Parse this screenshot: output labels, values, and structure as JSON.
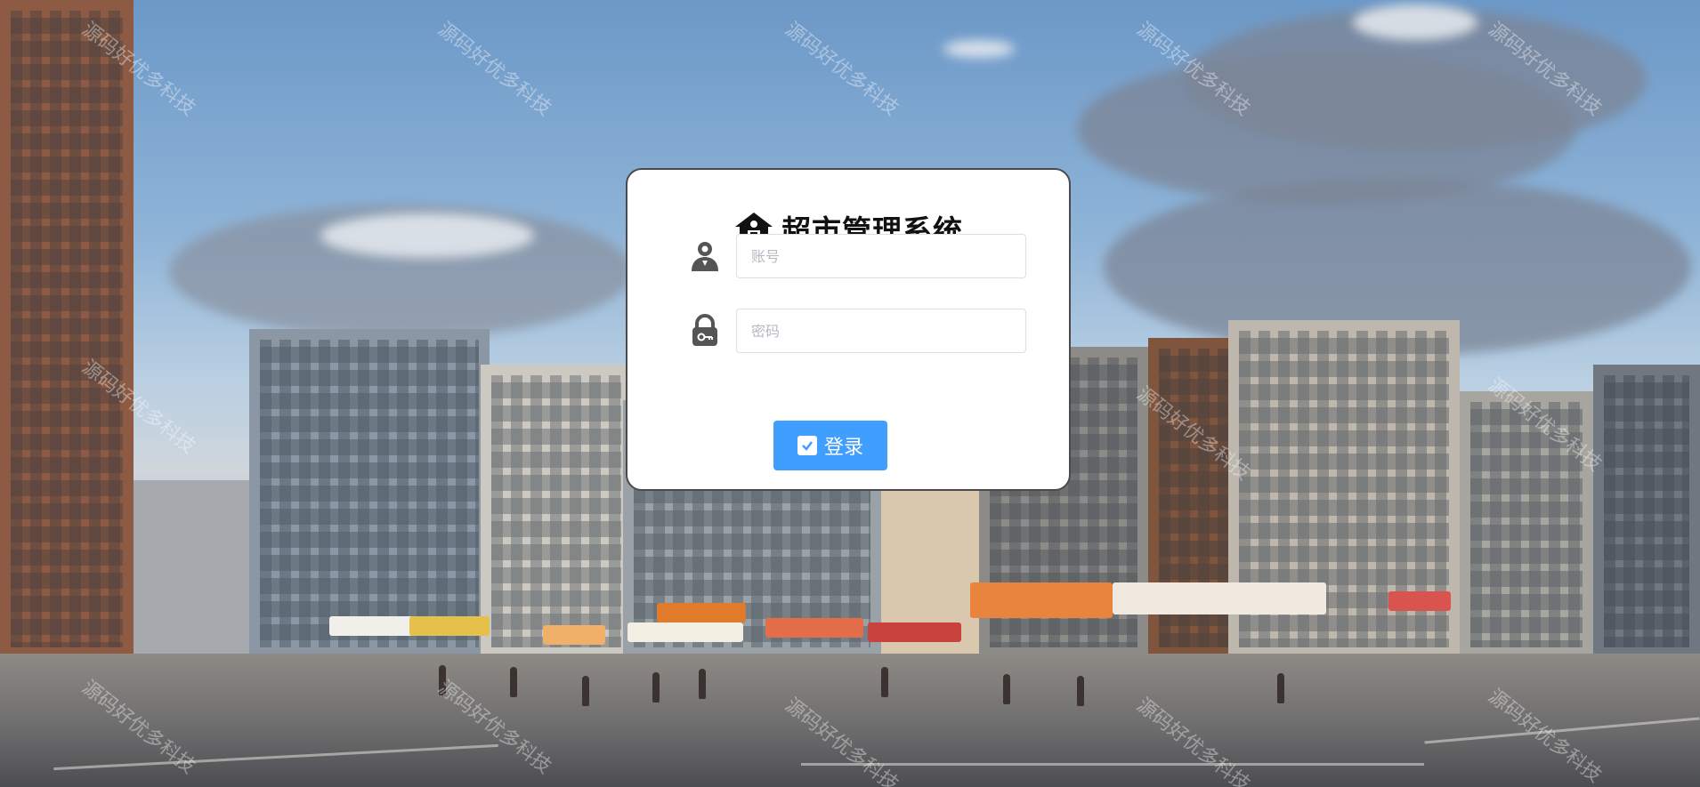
{
  "app": {
    "title": "超市管理系统"
  },
  "login": {
    "username_placeholder": "账号",
    "username_value": "",
    "password_placeholder": "密码",
    "password_value": "",
    "submit_label": "登录"
  },
  "watermark": {
    "text": "源码好优多科技"
  },
  "icons": {
    "title": "house-icon",
    "username": "user-icon",
    "password": "lock-icon",
    "submit": "check-icon"
  },
  "colors": {
    "primary_button": "#409eff",
    "card_border": "#4a4a4a",
    "title_text": "#111111"
  }
}
